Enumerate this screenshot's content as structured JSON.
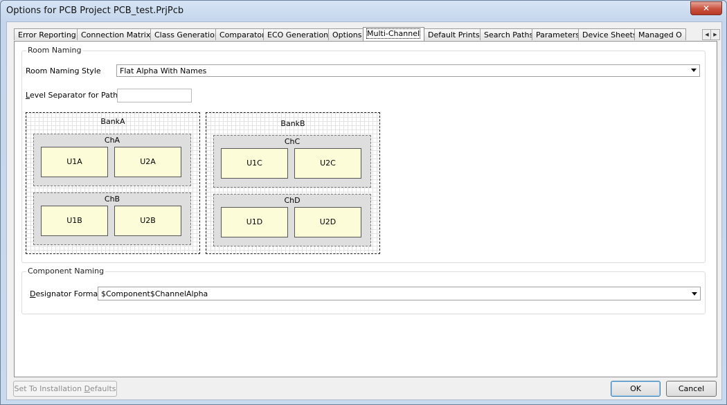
{
  "window": {
    "title": "Options for PCB Project PCB_test.PrjPcb",
    "close_label": "✕"
  },
  "tabs": [
    {
      "label": "Error Reporting"
    },
    {
      "label": "Connection Matrix"
    },
    {
      "label": "Class Generation"
    },
    {
      "label": "Comparator"
    },
    {
      "label": "ECO Generation"
    },
    {
      "label": "Options"
    },
    {
      "label": "Multi-Channel",
      "active": true
    },
    {
      "label": "Default Prints"
    },
    {
      "label": "Search Paths"
    },
    {
      "label": "Parameters"
    },
    {
      "label": "Device Sheets"
    },
    {
      "label": "Managed O"
    }
  ],
  "tab_scroll": {
    "left": "◀",
    "right": "▶"
  },
  "room_naming": {
    "group_title": "Room Naming",
    "style_label": "Room Naming Style",
    "style_value": "Flat Alpha With Names",
    "separator_label_prefix": "",
    "separator_label_hotkey": "L",
    "separator_label_rest": "evel Separator for Paths",
    "separator_value": ""
  },
  "diagram": {
    "banks": [
      {
        "name": "BankA",
        "channels": [
          {
            "name": "ChA",
            "components": [
              "U1A",
              "U2A"
            ]
          },
          {
            "name": "ChB",
            "components": [
              "U1B",
              "U2B"
            ]
          }
        ]
      },
      {
        "name": "BankB",
        "channels": [
          {
            "name": "ChC",
            "components": [
              "U1C",
              "U2C"
            ]
          },
          {
            "name": "ChD",
            "components": [
              "U1D",
              "U2D"
            ]
          }
        ]
      }
    ]
  },
  "component_naming": {
    "group_title": "Component Naming",
    "designator_hotkey": "D",
    "designator_rest": "esignator Format",
    "designator_value": "$Component$ChannelAlpha"
  },
  "buttons": {
    "defaults_prefix": "Set To Installation ",
    "defaults_hotkey": "D",
    "defaults_rest": "efaults",
    "ok": "OK",
    "cancel": "Cancel"
  },
  "colors": {
    "component_fill": "#fdfcd8",
    "channel_fill": "#dedede",
    "close_button": "#c8513d"
  }
}
